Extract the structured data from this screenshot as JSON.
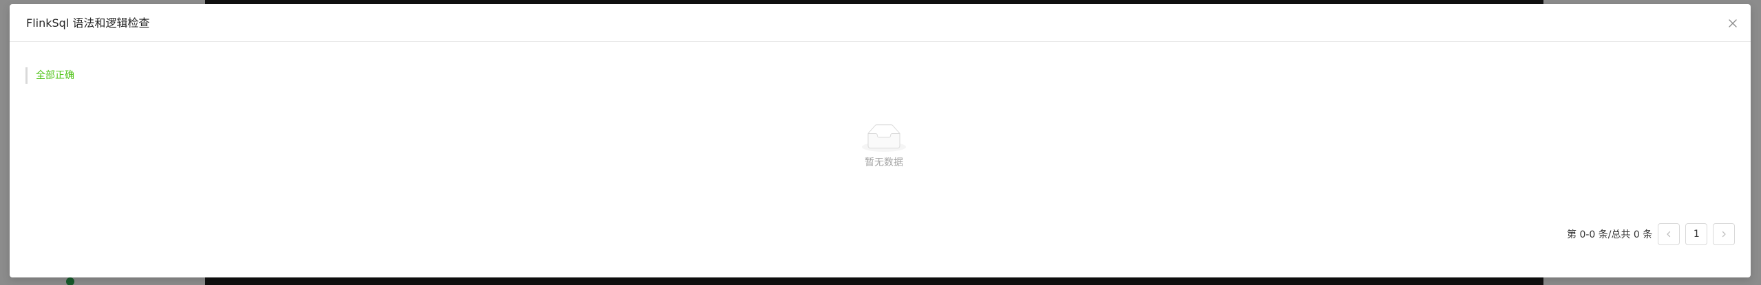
{
  "modal": {
    "title": "FlinkSql 语法和逻辑检查",
    "status_text": "全部正确",
    "status_color": "#52c41a",
    "close_icon": "close-icon"
  },
  "empty_state": {
    "icon": "empty-inbox-icon",
    "text": "暂无数据"
  },
  "pagination": {
    "total_text": "第 0-0 条/总共 0 条",
    "current_page": "1",
    "prev_icon": "chevron-left-icon",
    "next_icon": "chevron-right-icon"
  }
}
